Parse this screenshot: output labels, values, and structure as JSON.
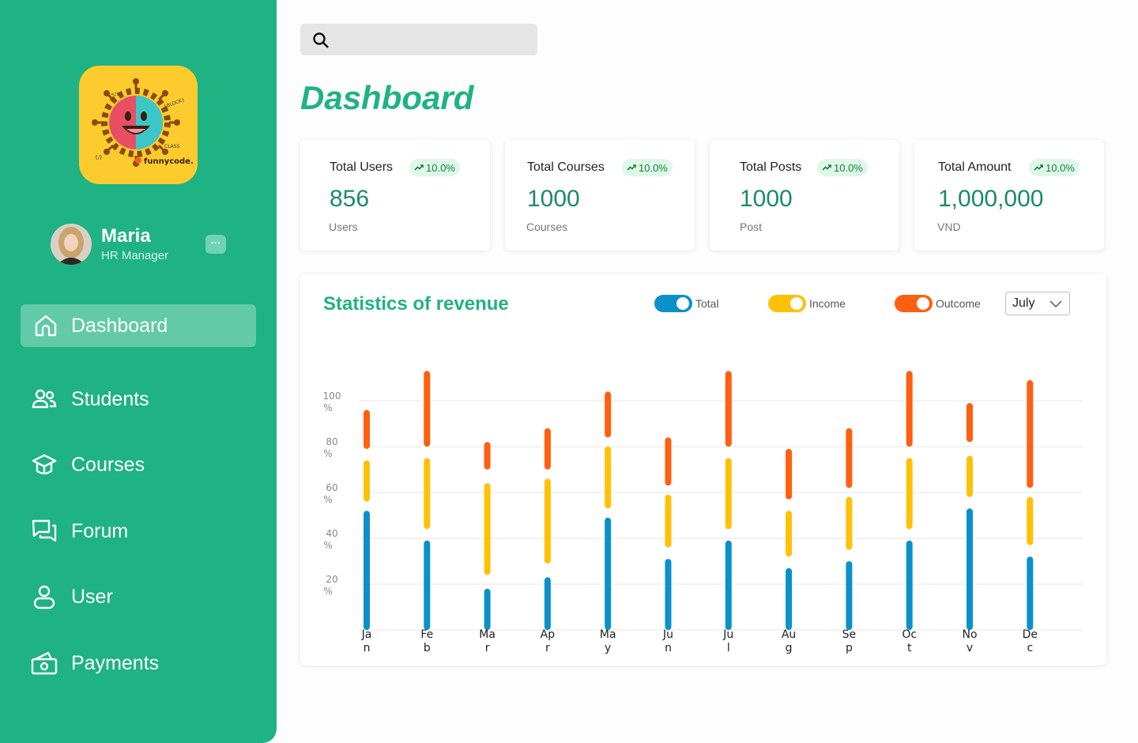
{
  "brand": {
    "logo_alt": "funnycode logo",
    "logo_text": "funnycode",
    "logo_words": [
      "{BLOCK}",
      "CLASS",
      "</>",
      "{/}"
    ]
  },
  "profile": {
    "name": "Maria",
    "role": "HR Manager",
    "more_label": "···"
  },
  "sidebar": {
    "items": [
      {
        "label": "Dashboard",
        "icon": "home-icon",
        "active": true
      },
      {
        "label": "Students",
        "icon": "users-icon",
        "active": false
      },
      {
        "label": "Courses",
        "icon": "graduation-cap-icon",
        "active": false
      },
      {
        "label": "Forum",
        "icon": "chat-icon",
        "active": false
      },
      {
        "label": "User",
        "icon": "user-icon",
        "active": false
      },
      {
        "label": "Payments",
        "icon": "wallet-icon",
        "active": false
      }
    ]
  },
  "search": {
    "placeholder": ""
  },
  "page": {
    "title": "Dashboard"
  },
  "stats": [
    {
      "title": "Total Users",
      "badge": "10.0%",
      "value": "856",
      "unit": "Users"
    },
    {
      "title": "Total Courses",
      "badge": "10.0%",
      "value": "1000",
      "unit": "Courses"
    },
    {
      "title": "Total Posts",
      "badge": "10.0%",
      "value": "1000",
      "unit": "Post"
    },
    {
      "title": "Total Amount",
      "badge": "10.0%",
      "value": "1,000,000",
      "unit": "VND"
    }
  ],
  "revenue": {
    "title": "Statistics of revenue",
    "legend": [
      {
        "label": "Total",
        "color": "#0b91c9",
        "on": true
      },
      {
        "label": "Income",
        "color": "#ffc107",
        "on": true
      },
      {
        "label": "Outcome",
        "color": "#ff5f0f",
        "on": true
      }
    ],
    "month_select": "July"
  },
  "colors": {
    "primary": "#1fb283",
    "total": "#0b91c9",
    "income": "#ffc107",
    "outcome": "#ff5f0f",
    "badge_bg": "#dff7e8",
    "badge_text": "#15803d"
  },
  "chart_data": {
    "type": "bar",
    "title": "Statistics of revenue",
    "categories": [
      "Jan",
      "Feb",
      "Mar",
      "Apr",
      "May",
      "Jun",
      "Jul",
      "Aug",
      "Sep",
      "Oct",
      "Nov",
      "Dec"
    ],
    "category_labels": [
      [
        "Ja",
        "n"
      ],
      [
        "Fe",
        "b"
      ],
      [
        "Ma",
        "r"
      ],
      [
        "Ap",
        "r"
      ],
      [
        "Ma",
        "y"
      ],
      [
        "Ju",
        "n"
      ],
      [
        "Ju",
        "l"
      ],
      [
        "Au",
        "g"
      ],
      [
        "Se",
        "p"
      ],
      [
        "Oc",
        "t"
      ],
      [
        "No",
        "v"
      ],
      [
        "De",
        "c"
      ]
    ],
    "y_ticks": [
      20,
      40,
      60,
      80,
      100
    ],
    "y_tick_labels": [
      [
        "20",
        "%"
      ],
      [
        "40",
        "%"
      ],
      [
        "60",
        "%"
      ],
      [
        "80",
        "%"
      ],
      [
        "100",
        "%"
      ]
    ],
    "ylim": [
      0,
      100
    ],
    "grid": true,
    "series": [
      {
        "name": "Total",
        "color": "#0b91c9",
        "ranges": [
          [
            0,
            52
          ],
          [
            0,
            39
          ],
          [
            0,
            18
          ],
          [
            0,
            23
          ],
          [
            0,
            49
          ],
          [
            0,
            31
          ],
          [
            0,
            39
          ],
          [
            0,
            27
          ],
          [
            0,
            30
          ],
          [
            0,
            39
          ],
          [
            0,
            53
          ],
          [
            0,
            32
          ]
        ]
      },
      {
        "name": "Income",
        "color": "#ffc107",
        "ranges": [
          [
            56,
            74
          ],
          [
            44,
            75
          ],
          [
            24,
            64
          ],
          [
            29,
            66
          ],
          [
            53,
            80
          ],
          [
            36,
            59
          ],
          [
            44,
            75
          ],
          [
            32,
            52
          ],
          [
            35,
            58
          ],
          [
            44,
            75
          ],
          [
            58,
            76
          ],
          [
            37,
            58
          ]
        ]
      },
      {
        "name": "Outcome",
        "color": "#ff5f0f",
        "ranges": [
          [
            79,
            96
          ],
          [
            80,
            113
          ],
          [
            70,
            82
          ],
          [
            70,
            88
          ],
          [
            84,
            104
          ],
          [
            63,
            84
          ],
          [
            80,
            113
          ],
          [
            57,
            79
          ],
          [
            62,
            88
          ],
          [
            80,
            113
          ],
          [
            82,
            99
          ],
          [
            62,
            109
          ]
        ]
      }
    ]
  }
}
